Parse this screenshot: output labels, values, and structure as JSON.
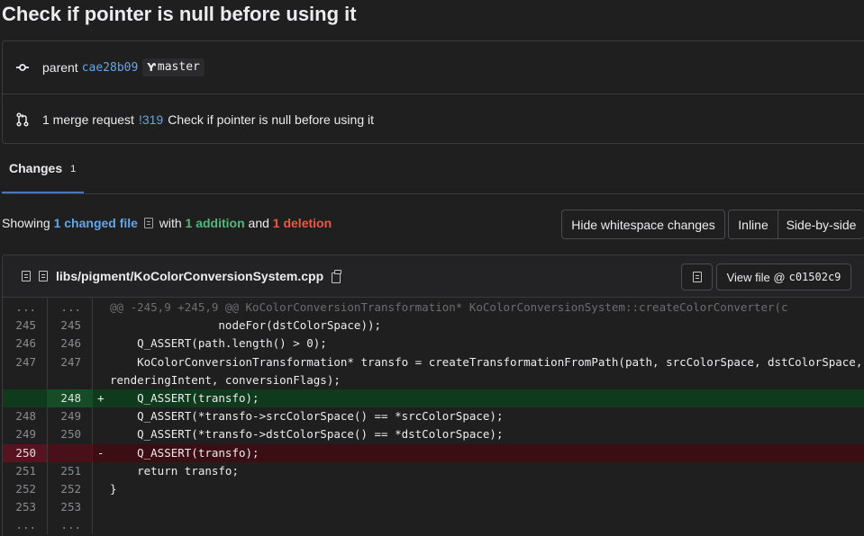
{
  "commit": {
    "title": "Check if pointer is null before using it",
    "parent_label": "parent",
    "parent_sha": "cae28b09",
    "branch": "master",
    "merge_count_label": "1 merge request",
    "merge_ref": "!319",
    "merge_title": "Check if pointer is null before using it"
  },
  "tabs": [
    {
      "label": "Changes",
      "count": "1"
    }
  ],
  "summary": {
    "showing": "Showing",
    "changed_files": "1 changed file",
    "with": "with",
    "additions": "1 addition",
    "and": "and",
    "deletions": "1 deletion"
  },
  "toolbar": {
    "hide_whitespace": "Hide whitespace changes",
    "inline": "Inline",
    "side_by_side": "Side-by-side"
  },
  "file": {
    "path": "libs/pigment/KoColorConversionSystem.cpp",
    "view_file_label": "View file @",
    "view_file_sha": "c01502c9"
  },
  "diff_lines": [
    {
      "type": "hunk",
      "old": "...",
      "new": "...",
      "marker": "",
      "code": "@@ -245,9 +245,9 @@ KoColorConversionTransformation* KoColorConversionSystem::createColorConverter(c"
    },
    {
      "type": "ctx",
      "old": "245",
      "new": "245",
      "marker": "",
      "code": "                nodeFor(dstColorSpace));"
    },
    {
      "type": "ctx",
      "old": "246",
      "new": "246",
      "marker": "",
      "code": "    Q_ASSERT(path.length() > 0);"
    },
    {
      "type": "ctx",
      "old": "247",
      "new": "247",
      "marker": "",
      "code": "    KoColorConversionTransformation* transfo = createTransformationFromPath(path, srcColorSpace, dstColorSpace, renderingIntent, conversionFlags);"
    },
    {
      "type": "add",
      "old": "",
      "new": "248",
      "marker": "+",
      "code": "    Q_ASSERT(transfo);"
    },
    {
      "type": "ctx",
      "old": "248",
      "new": "249",
      "marker": "",
      "code": "    Q_ASSERT(*transfo->srcColorSpace() == *srcColorSpace);"
    },
    {
      "type": "ctx",
      "old": "249",
      "new": "250",
      "marker": "",
      "code": "    Q_ASSERT(*transfo->dstColorSpace() == *dstColorSpace);"
    },
    {
      "type": "del",
      "old": "250",
      "new": "",
      "marker": "-",
      "code": "    Q_ASSERT(transfo);"
    },
    {
      "type": "ctx",
      "old": "251",
      "new": "251",
      "marker": "",
      "code": "    return transfo;"
    },
    {
      "type": "ctx",
      "old": "252",
      "new": "252",
      "marker": "",
      "code": "}"
    },
    {
      "type": "ctx",
      "old": "253",
      "new": "253",
      "marker": "",
      "code": ""
    },
    {
      "type": "hunk",
      "old": "...",
      "new": "...",
      "marker": "",
      "code": ""
    }
  ],
  "colors": {
    "background": "#1f1f1f",
    "link": "#63a6e9",
    "addition": "#52b87a",
    "deletion": "#ec5941",
    "added_line_bg": "#0f3a1c",
    "deleted_line_bg": "#3b0e14",
    "active_tab": "#4b74c1"
  },
  "icons": {
    "commit": "commit-icon",
    "merge_request": "merge-request-icon",
    "branch": "branch-icon",
    "file": "file-icon",
    "copy": "copy-icon",
    "file_tree_toggle": "file-tree-toggle-icon"
  }
}
